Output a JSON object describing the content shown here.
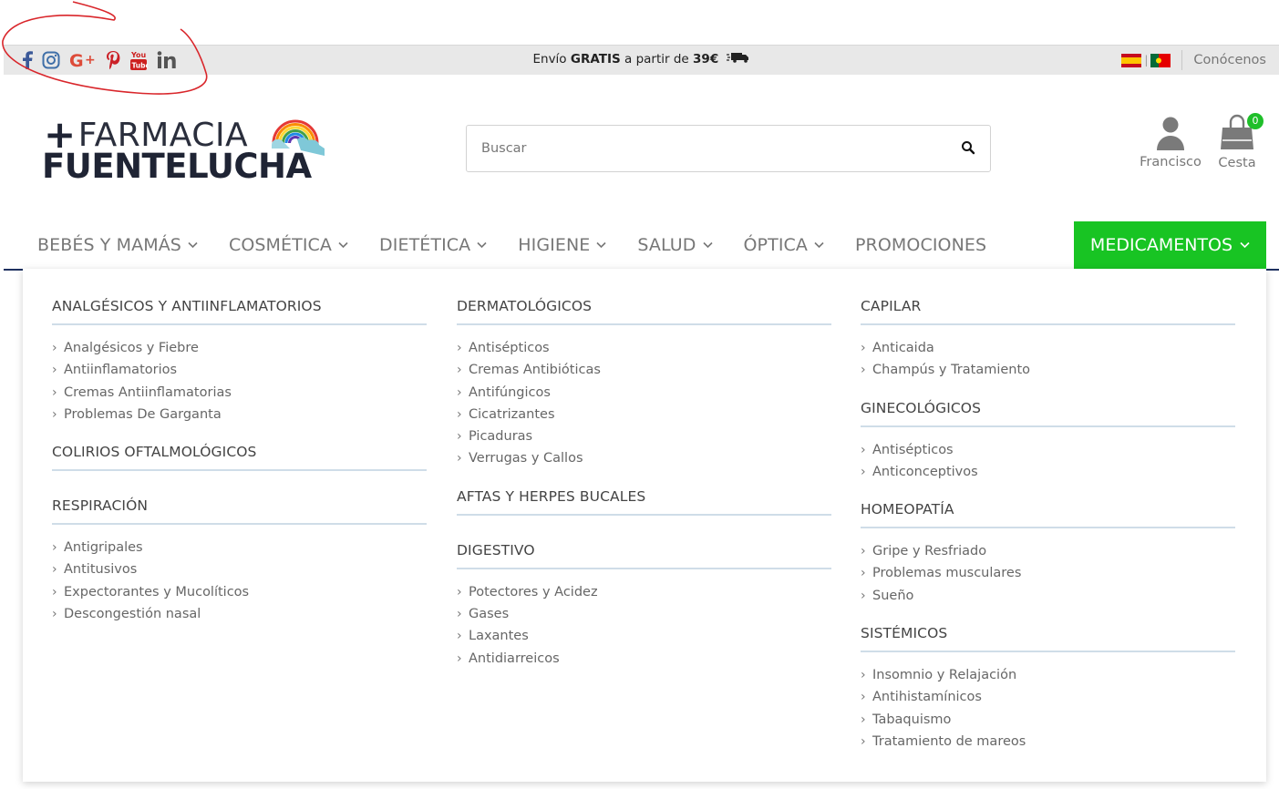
{
  "topbar": {
    "social_icons": [
      "facebook-icon",
      "instagram-icon",
      "google-plus-icon",
      "pinterest-icon",
      "youtube-icon",
      "linkedin-icon"
    ],
    "shipping_prefix": "Envío ",
    "shipping_bold": "GRATIS",
    "shipping_middle": " a partir de ",
    "shipping_amount": "39€",
    "languages": [
      "es-flag-icon",
      "pt-flag-icon"
    ],
    "about_label": "Conócenos"
  },
  "header": {
    "logo_line1": "FARMACIA",
    "logo_line2": "FUENTELUCHA",
    "search_placeholder": "Buscar",
    "user_label": "Francisco",
    "cart_label": "Cesta",
    "cart_count": "0"
  },
  "nav": {
    "items": [
      {
        "label": "BEBÉS Y MAMÁS",
        "has_dropdown": true
      },
      {
        "label": "COSMÉTICA",
        "has_dropdown": true
      },
      {
        "label": "DIETÉTICA",
        "has_dropdown": true
      },
      {
        "label": "HIGIENE",
        "has_dropdown": true
      },
      {
        "label": "SALUD",
        "has_dropdown": true
      },
      {
        "label": "ÓPTICA",
        "has_dropdown": true
      },
      {
        "label": "PROMOCIONES",
        "has_dropdown": false
      }
    ],
    "active": {
      "label": "MEDICAMENTOS",
      "has_dropdown": true
    },
    "active_color": "#18c423"
  },
  "mega_menu": {
    "columns": [
      [
        {
          "title": "ANALGÉSICOS Y ANTIINFLAMATORIOS",
          "items": [
            "Analgésicos y Fiebre",
            "Antiinflamatorios",
            "Cremas Antiinflamatorias",
            "Problemas De Garganta"
          ]
        },
        {
          "title": "COLIRIOS OFTALMOLÓGICOS",
          "items": []
        },
        {
          "title": "RESPIRACIÓN",
          "items": [
            "Antigripales",
            "Antitusivos",
            "Expectorantes y Mucolíticos",
            "Descongestión nasal"
          ]
        }
      ],
      [
        {
          "title": "DERMATOLÓGICOS",
          "items": [
            "Antisépticos",
            "Cremas Antibióticas",
            "Antifúngicos",
            "Cicatrizantes",
            "Picaduras",
            "Verrugas y Callos"
          ]
        },
        {
          "title": "AFTAS Y HERPES BUCALES",
          "items": []
        },
        {
          "title": "DIGESTIVO",
          "items": [
            "Potectores y Acidez",
            "Gases",
            "Laxantes",
            "Antidiarreicos"
          ]
        }
      ],
      [
        {
          "title": "CAPILAR",
          "items": [
            "Anticaida",
            "Champús y Tratamiento"
          ]
        },
        {
          "title": "GINECOLÓGICOS",
          "items": [
            "Antisépticos",
            "Anticonceptivos"
          ]
        },
        {
          "title": "HOMEOPATÍA",
          "items": [
            "Gripe y Resfriado",
            "Problemas musculares",
            "Sueño"
          ]
        },
        {
          "title": "SISTÉMICOS",
          "items": [
            "Insomnio y Relajación",
            "Antihistamínicos",
            "Tabaquismo",
            "Tratamiento de mareos"
          ]
        }
      ]
    ]
  }
}
